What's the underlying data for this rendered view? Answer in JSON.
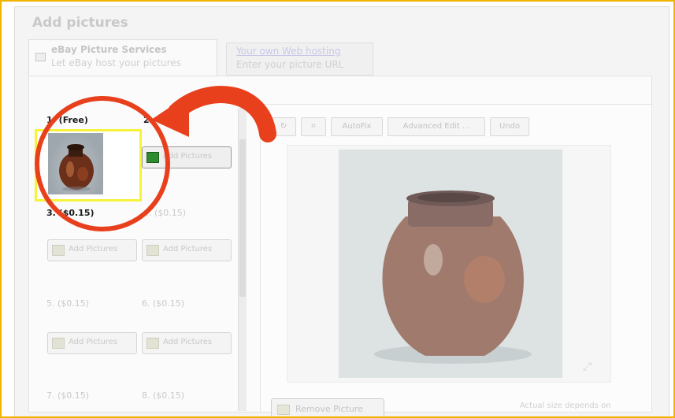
{
  "title": "Add pictures",
  "tabs": [
    {
      "label": "eBay Picture Services",
      "sub": "Let eBay host your pictures"
    },
    {
      "label": "Your own Web hosting",
      "sub": "Enter your picture URL"
    }
  ],
  "slots": [
    {
      "label": "1. (Free)"
    },
    {
      "label": "2."
    },
    {
      "label": "3. ($0.15)"
    },
    {
      "label": "4. ($0.15)"
    },
    {
      "label": "5. ($0.15)"
    },
    {
      "label": "6. ($0.15)"
    },
    {
      "label": "7. ($0.15)"
    },
    {
      "label": "8. ($0.15)"
    }
  ],
  "add_picture_label": "Add Pictures",
  "toolbar": {
    "autofix": "AutoFix",
    "advanced_edit": "Advanced Edit ...",
    "undo": "Undo"
  },
  "remove_label": "Remove Picture",
  "note": "Actual size depends on",
  "colors": {
    "annotation": "#e8401c",
    "frame": "#f0b400",
    "selection": "#f7f23b"
  },
  "icons": [
    "camera-icon",
    "rotate-icon",
    "crop-icon",
    "add-picture-icon",
    "remove-picture-icon",
    "arrow-annotation",
    "circle-annotation"
  ]
}
